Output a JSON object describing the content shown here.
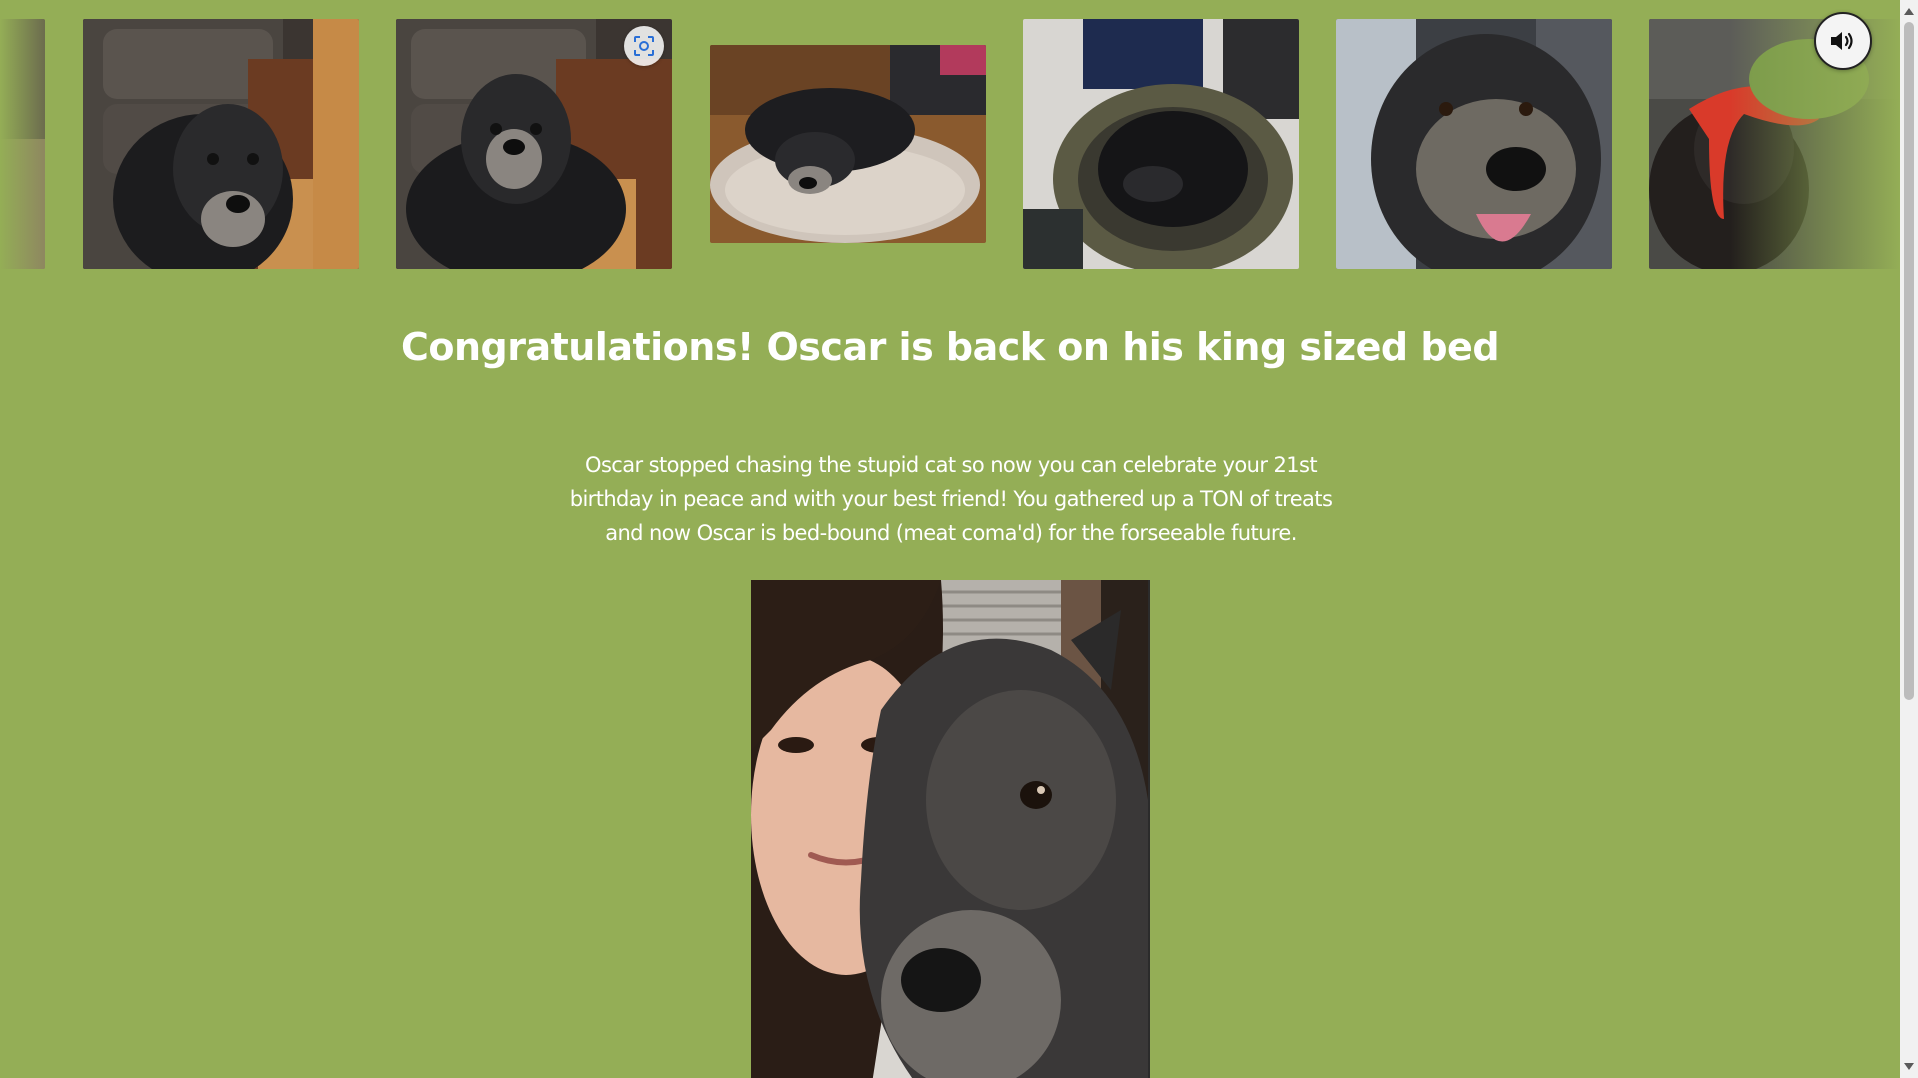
{
  "carousel": {
    "photos": [
      {
        "name": "oscar-photo-partial-left"
      },
      {
        "name": "oscar-by-leather-chair-1"
      },
      {
        "name": "oscar-by-leather-chair-2"
      },
      {
        "name": "oscar-on-pet-bed"
      },
      {
        "name": "oscar-curled-in-bed"
      },
      {
        "name": "oscar-tongue-out-in-car"
      },
      {
        "name": "oscar-with-red-toy"
      }
    ],
    "lens_icon": "lens-scan-icon",
    "sound_icon": "speaker-volume-icon"
  },
  "title": "Congratulations! Oscar is back on his king sized bed",
  "message": "Oscar stopped chasing the stupid cat so now you can celebrate your 21st birthday in peace and with your best friend! You gathered up a TON of treats and now Oscar is bed-bound (meat coma'd) for the forseeable future.",
  "colors": {
    "background": "#94ae56",
    "text": "#ffffff"
  }
}
